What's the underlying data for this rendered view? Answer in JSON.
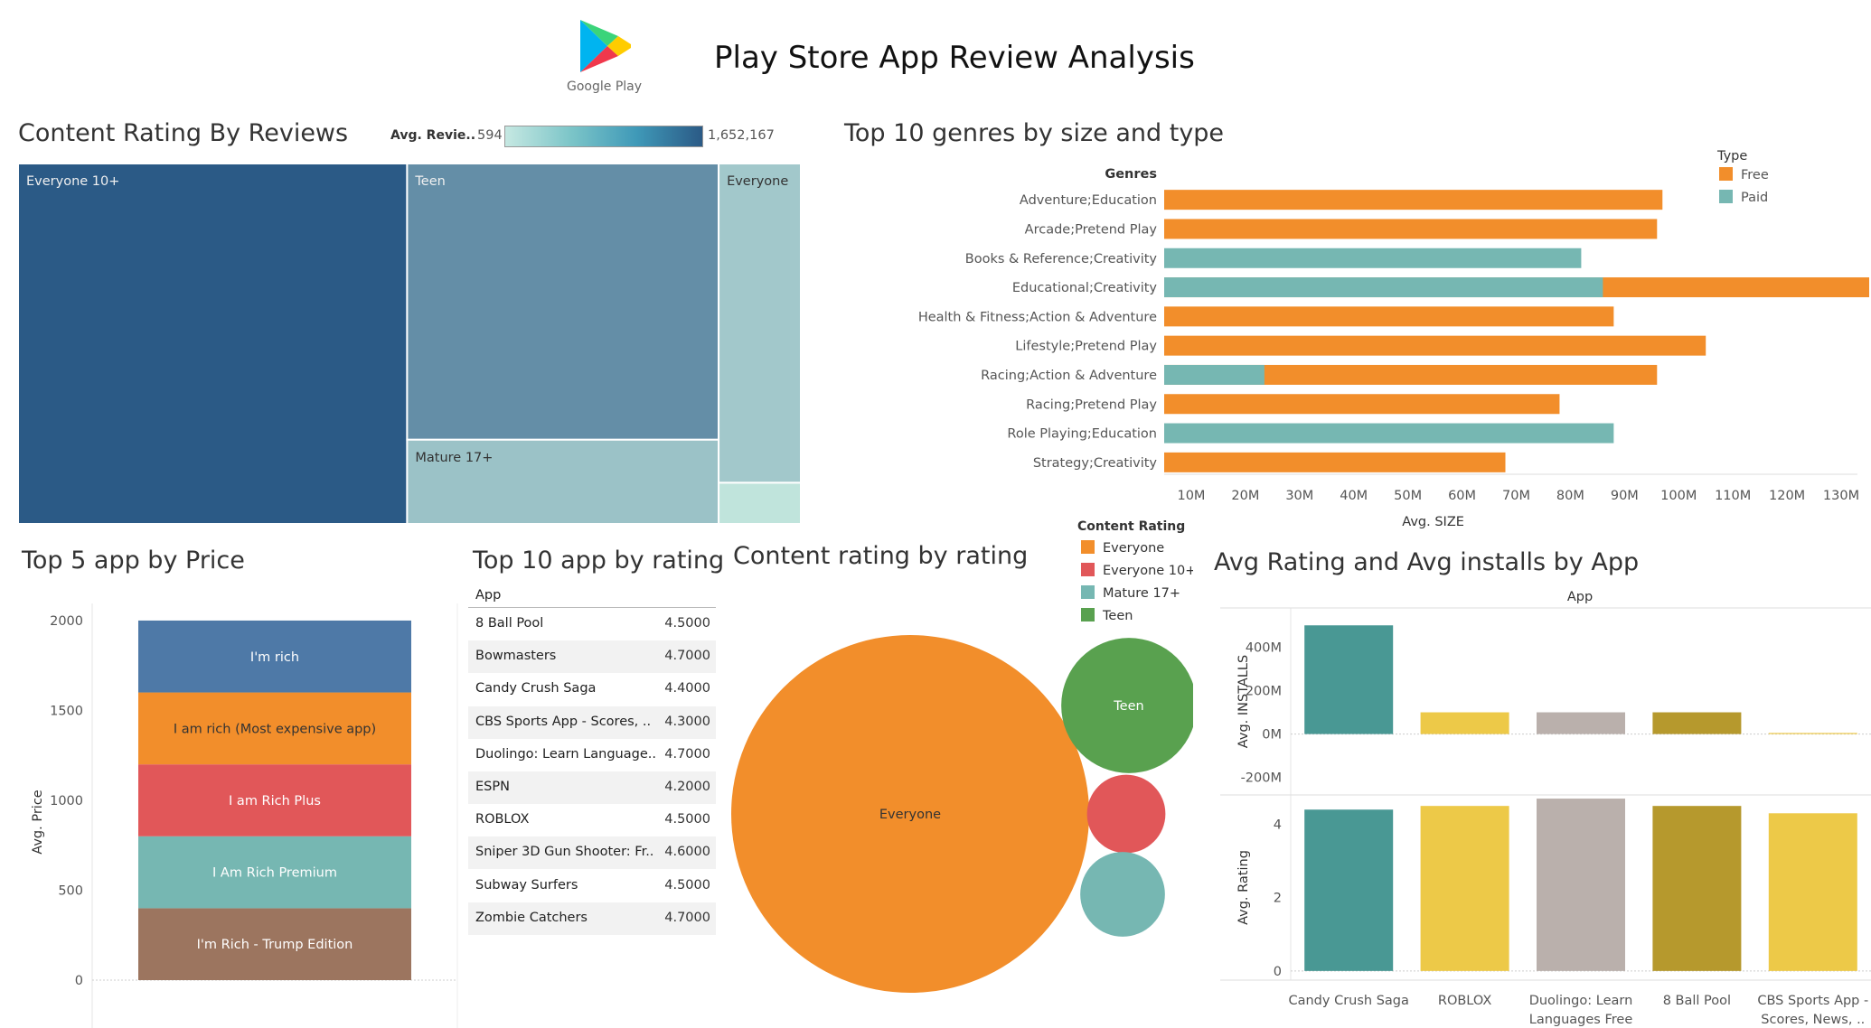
{
  "header": {
    "title": "Play Store App Review Analysis",
    "logo_text": "Google Play"
  },
  "treemap": {
    "title": "Content Rating By Reviews",
    "legend_label": "Avg. Revie..",
    "legend_min": "594",
    "legend_max": "1,652,167",
    "colors": {
      "low": "#c0e4dc",
      "high": "#2b5a86"
    }
  },
  "genres_chart": {
    "title": "Top 10 genres by size and type"
  },
  "price_chart": {
    "title": "Top 5 app by Price"
  },
  "rating_table": {
    "title": "Top 10 app by rating",
    "column_header": "App",
    "rows": [
      {
        "app": "8 Ball Pool",
        "rating": "4.5000"
      },
      {
        "app": "Bowmasters",
        "rating": "4.7000"
      },
      {
        "app": "Candy Crush Saga",
        "rating": "4.4000"
      },
      {
        "app": "CBS Sports App - Scores, ..",
        "rating": "4.3000"
      },
      {
        "app": "Duolingo: Learn Language..",
        "rating": "4.7000"
      },
      {
        "app": "ESPN",
        "rating": "4.2000"
      },
      {
        "app": "ROBLOX",
        "rating": "4.5000"
      },
      {
        "app": "Sniper 3D Gun Shooter: Fr..",
        "rating": "4.6000"
      },
      {
        "app": "Subway Surfers",
        "rating": "4.5000"
      },
      {
        "app": "Zombie Catchers",
        "rating": "4.7000"
      }
    ]
  },
  "bubble_chart": {
    "title": "Content rating by rating"
  },
  "installs_chart": {
    "title": "Avg Rating and Avg installs by App"
  },
  "chart_data": [
    {
      "type": "treemap",
      "title": "Content Rating By Reviews",
      "color_measure": "Avg. Revie..",
      "color_range": [
        594,
        1652167
      ],
      "items": [
        {
          "label": "Everyone 10+",
          "size_share": 0.497,
          "color_share": 1.0
        },
        {
          "label": "Teen",
          "size_share": 0.305,
          "color_share": 0.62
        },
        {
          "label": "Mature 17+",
          "size_share": 0.093,
          "color_share": 0.25
        },
        {
          "label": "Everyone",
          "size_share": 0.093,
          "color_share": 0.2
        },
        {
          "label": "",
          "size_share": 0.012,
          "color_share": 0.0
        }
      ]
    },
    {
      "type": "bar",
      "orientation": "horizontal",
      "title": "Top 10 genres by size and type",
      "y_header": "Genres",
      "xlabel": "Avg. SIZE",
      "xlim": [
        5000000,
        133000000
      ],
      "xticks": [
        10000000,
        20000000,
        30000000,
        40000000,
        50000000,
        60000000,
        70000000,
        80000000,
        90000000,
        100000000,
        110000000,
        120000000,
        130000000
      ],
      "xtick_labels": [
        "10M",
        "20M",
        "30M",
        "40M",
        "50M",
        "60M",
        "70M",
        "80M",
        "90M",
        "100M",
        "110M",
        "120M",
        "130M"
      ],
      "legend_title": "Type",
      "legend_position": "top-right",
      "categories": [
        "Adventure;Education",
        "Arcade;Pretend Play",
        "Books & Reference;Creativity",
        "Educational;Creativity",
        "Health & Fitness;Action & Adventure",
        "Lifestyle;Pretend Play",
        "Racing;Action & Adventure",
        "Racing;Pretend Play",
        "Role Playing;Education",
        "Strategy;Creativity"
      ],
      "series": [
        {
          "name": "Free",
          "color": "#f28e2b",
          "values": [
            92000000,
            91000000,
            0,
            134000000,
            83000000,
            100000000,
            91000000,
            73000000,
            0,
            63000000
          ]
        },
        {
          "name": "Paid",
          "color": "#76b7b2",
          "values": [
            0,
            0,
            77000000,
            81000000,
            0,
            0,
            18500000,
            0,
            83000000,
            0
          ]
        }
      ]
    },
    {
      "type": "bar",
      "stacked": true,
      "title": "Top 5 app by Price",
      "ylabel": "Avg. Price",
      "ylim": [
        0,
        2050
      ],
      "yticks": [
        0,
        500,
        1000,
        1500,
        2000
      ],
      "segments": [
        {
          "label": "I'm Rich - Trump Edition",
          "value": 400,
          "color": "#9c755f"
        },
        {
          "label": "I Am Rich Premium",
          "value": 400,
          "color": "#76b7b2"
        },
        {
          "label": "I am Rich Plus",
          "value": 400,
          "color": "#e15759"
        },
        {
          "label": "I am rich (Most expensive app)",
          "value": 400,
          "color": "#f28e2b"
        },
        {
          "label": "I'm rich",
          "value": 400,
          "color": "#4e79a7"
        }
      ]
    },
    {
      "type": "bubble",
      "title": "Content rating by rating",
      "legend_title": "Content Rating",
      "legend_position": "top-right",
      "legend": [
        {
          "name": "Everyone",
          "color": "#f28e2b"
        },
        {
          "name": "Everyone 10+",
          "color": "#e15759"
        },
        {
          "name": "Mature 17+",
          "color": "#76b7b2"
        },
        {
          "name": "Teen",
          "color": "#59a14f"
        }
      ],
      "bubbles": [
        {
          "label": "Everyone",
          "value": 100,
          "color": "#f28e2b",
          "show_label": true
        },
        {
          "label": "Teen",
          "value": 14.3,
          "color": "#59a14f",
          "show_label": true
        },
        {
          "label": "Everyone 10+",
          "value": 4.8,
          "color": "#e15759",
          "show_label": false
        },
        {
          "label": "Mature 17+",
          "value": 5.6,
          "color": "#76b7b2",
          "show_label": false
        }
      ]
    },
    {
      "type": "bar",
      "title": "Avg Rating and Avg installs by App",
      "column_header": "App",
      "categories": [
        "Candy Crush Saga",
        "ROBLOX",
        "Duolingo: Learn Languages Free",
        "8 Ball Pool",
        "CBS Sports App - Scores, News, .."
      ],
      "category_labels": [
        [
          "Candy Crush Saga"
        ],
        [
          "ROBLOX"
        ],
        [
          "Duolingo: Learn",
          "Languages Free"
        ],
        [
          "8 Ball Pool"
        ],
        [
          "CBS Sports App -",
          "Scores, News, .."
        ]
      ],
      "colors": [
        "#499894",
        "#edc948",
        "#bab0ac",
        "#b6992d",
        "#edc948"
      ],
      "panels": [
        {
          "ylabel": "Avg. INSTALLS",
          "ylim": [
            -280000000,
            580000000
          ],
          "yticks": [
            -200000000,
            0,
            200000000,
            400000000
          ],
          "ytick_labels": [
            "-200M",
            "0M",
            "200M",
            "400M"
          ],
          "values": [
            500000000,
            100000000,
            100000000,
            100000000,
            5000000
          ]
        },
        {
          "ylabel": "Avg. Rating",
          "ylim": [
            -0.25,
            4.8
          ],
          "yticks": [
            0,
            2,
            4
          ],
          "ytick_labels": [
            "0",
            "2",
            "4"
          ],
          "values": [
            4.4,
            4.5,
            4.7,
            4.5,
            4.3
          ]
        }
      ]
    }
  ]
}
